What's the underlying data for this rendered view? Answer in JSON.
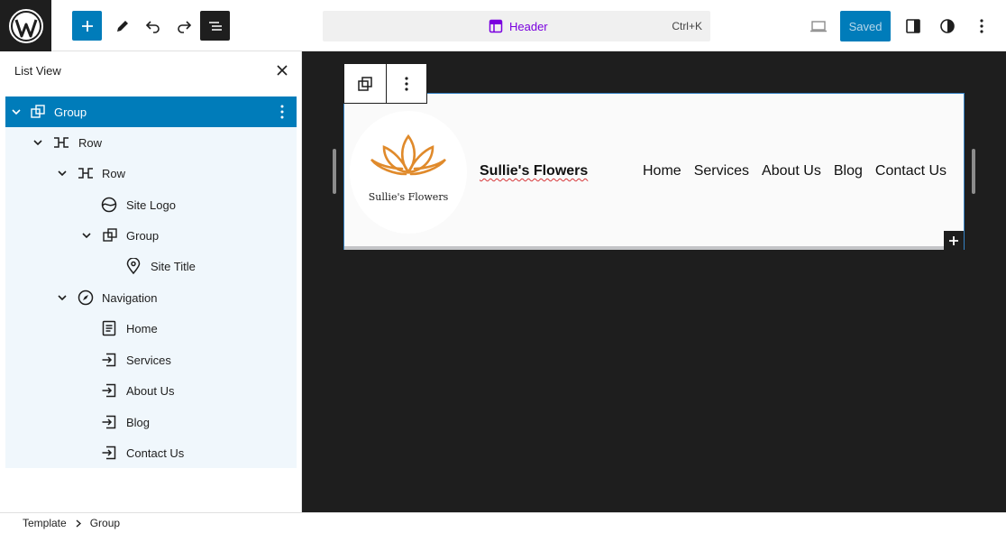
{
  "toolbar": {
    "command_label": "Header",
    "command_shortcut": "Ctrl+K",
    "saved_label": "Saved"
  },
  "list_view": {
    "title": "List View",
    "items": [
      {
        "label": "Group",
        "icon": "group-icon",
        "expanded": true,
        "selected": true
      },
      {
        "label": "Row",
        "icon": "row-icon",
        "expanded": true
      },
      {
        "label": "Row",
        "icon": "row-icon",
        "expanded": true
      },
      {
        "label": "Site Logo",
        "icon": "site-logo-icon"
      },
      {
        "label": "Group",
        "icon": "group-icon",
        "expanded": true
      },
      {
        "label": "Site Title",
        "icon": "map-marker-icon"
      },
      {
        "label": "Navigation",
        "icon": "compass-icon",
        "expanded": true
      },
      {
        "label": "Home",
        "icon": "page-icon"
      },
      {
        "label": "Services",
        "icon": "custom-link-icon"
      },
      {
        "label": "About Us",
        "icon": "custom-link-icon"
      },
      {
        "label": "Blog",
        "icon": "custom-link-icon"
      },
      {
        "label": "Contact Us",
        "icon": "custom-link-icon"
      }
    ]
  },
  "canvas": {
    "logo_text": "Sullie's Flowers",
    "site_title": "Sullie's Flowers",
    "nav": [
      "Home",
      "Services",
      "About Us",
      "Blog",
      "Contact Us"
    ]
  },
  "breadcrumb": [
    "Template",
    "Group"
  ],
  "colors": {
    "accent": "#007cba",
    "dark": "#1e1e1e",
    "command_text": "#7a00df",
    "tree_background": "#f0f7fc",
    "lotus": "#e08a2b"
  }
}
